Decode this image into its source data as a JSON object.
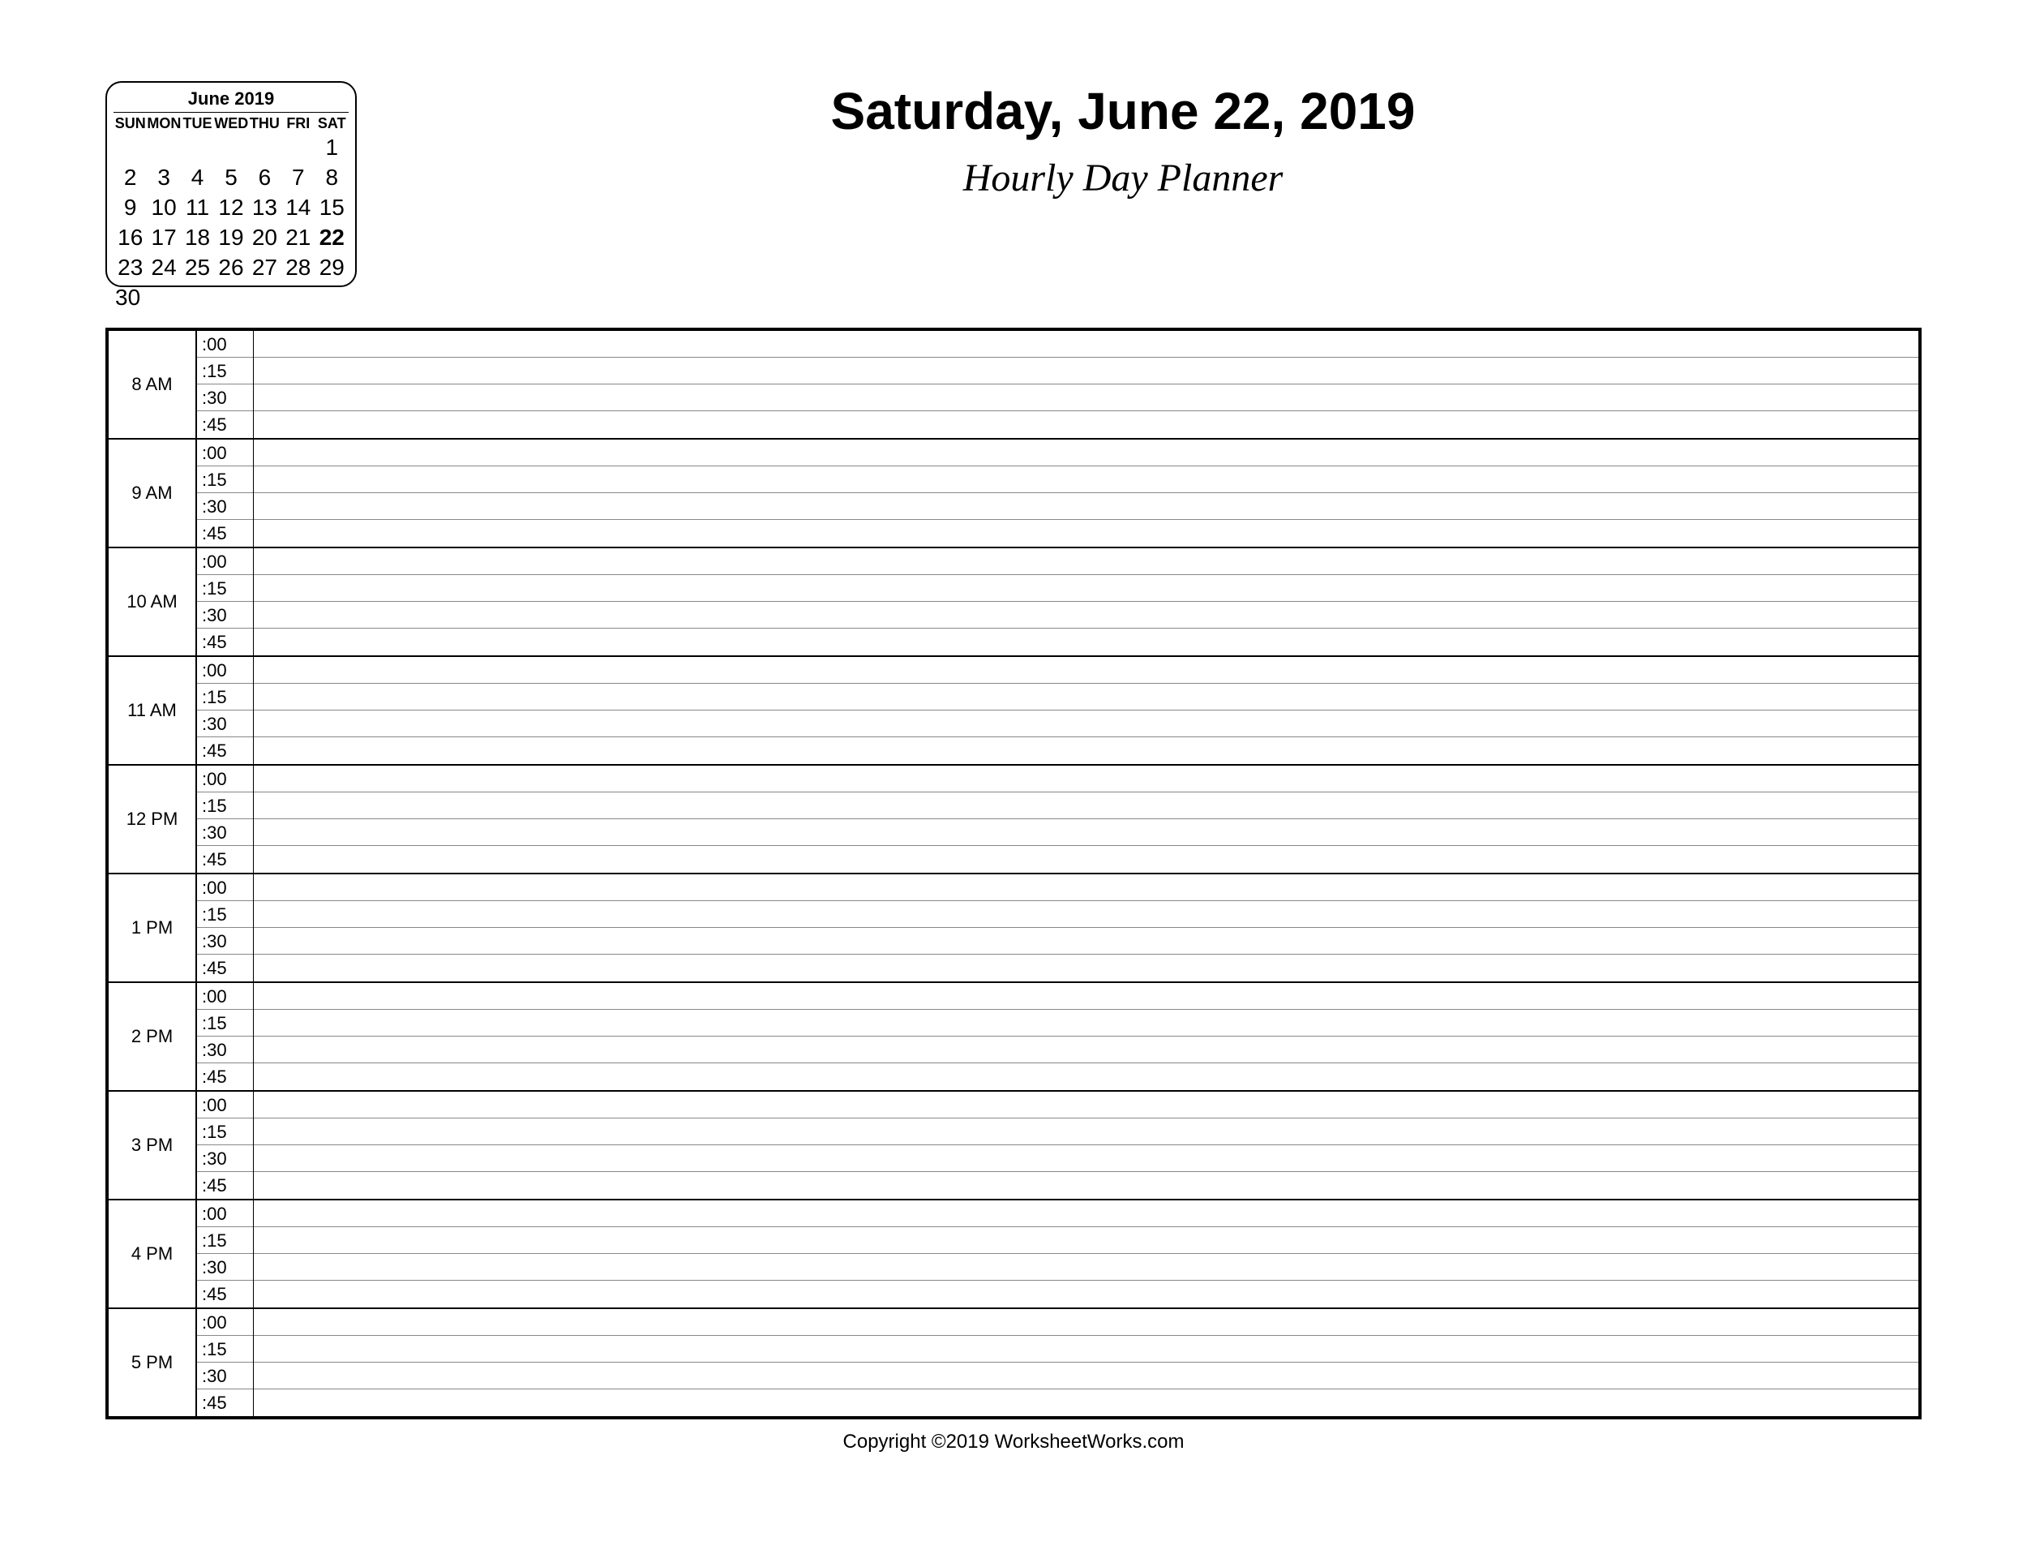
{
  "header": {
    "date_title": "Saturday, June 22, 2019",
    "subtitle": "Hourly Day Planner"
  },
  "mini_calendar": {
    "title": "June 2019",
    "day_headers": [
      "SUN",
      "MON",
      "TUE",
      "WED",
      "THU",
      "FRI",
      "SAT"
    ],
    "weeks": [
      [
        "",
        "",
        "",
        "",
        "",
        "",
        "1"
      ],
      [
        "2",
        "3",
        "4",
        "5",
        "6",
        "7",
        "8"
      ],
      [
        "9",
        "10",
        "11",
        "12",
        "13",
        "14",
        "15"
      ],
      [
        "16",
        "17",
        "18",
        "19",
        "20",
        "21",
        "22"
      ],
      [
        "23",
        "24",
        "25",
        "26",
        "27",
        "28",
        "29"
      ]
    ],
    "overflow_day": "30",
    "today": "22"
  },
  "planner": {
    "hours": [
      "8 AM",
      "9 AM",
      "10 AM",
      "11 AM",
      "12 PM",
      "1 PM",
      "2 PM",
      "3 PM",
      "4 PM",
      "5 PM"
    ],
    "minutes": [
      ":00",
      ":15",
      ":30",
      ":45"
    ]
  },
  "footer": {
    "copyright": "Copyright ©2019 WorksheetWorks.com"
  }
}
